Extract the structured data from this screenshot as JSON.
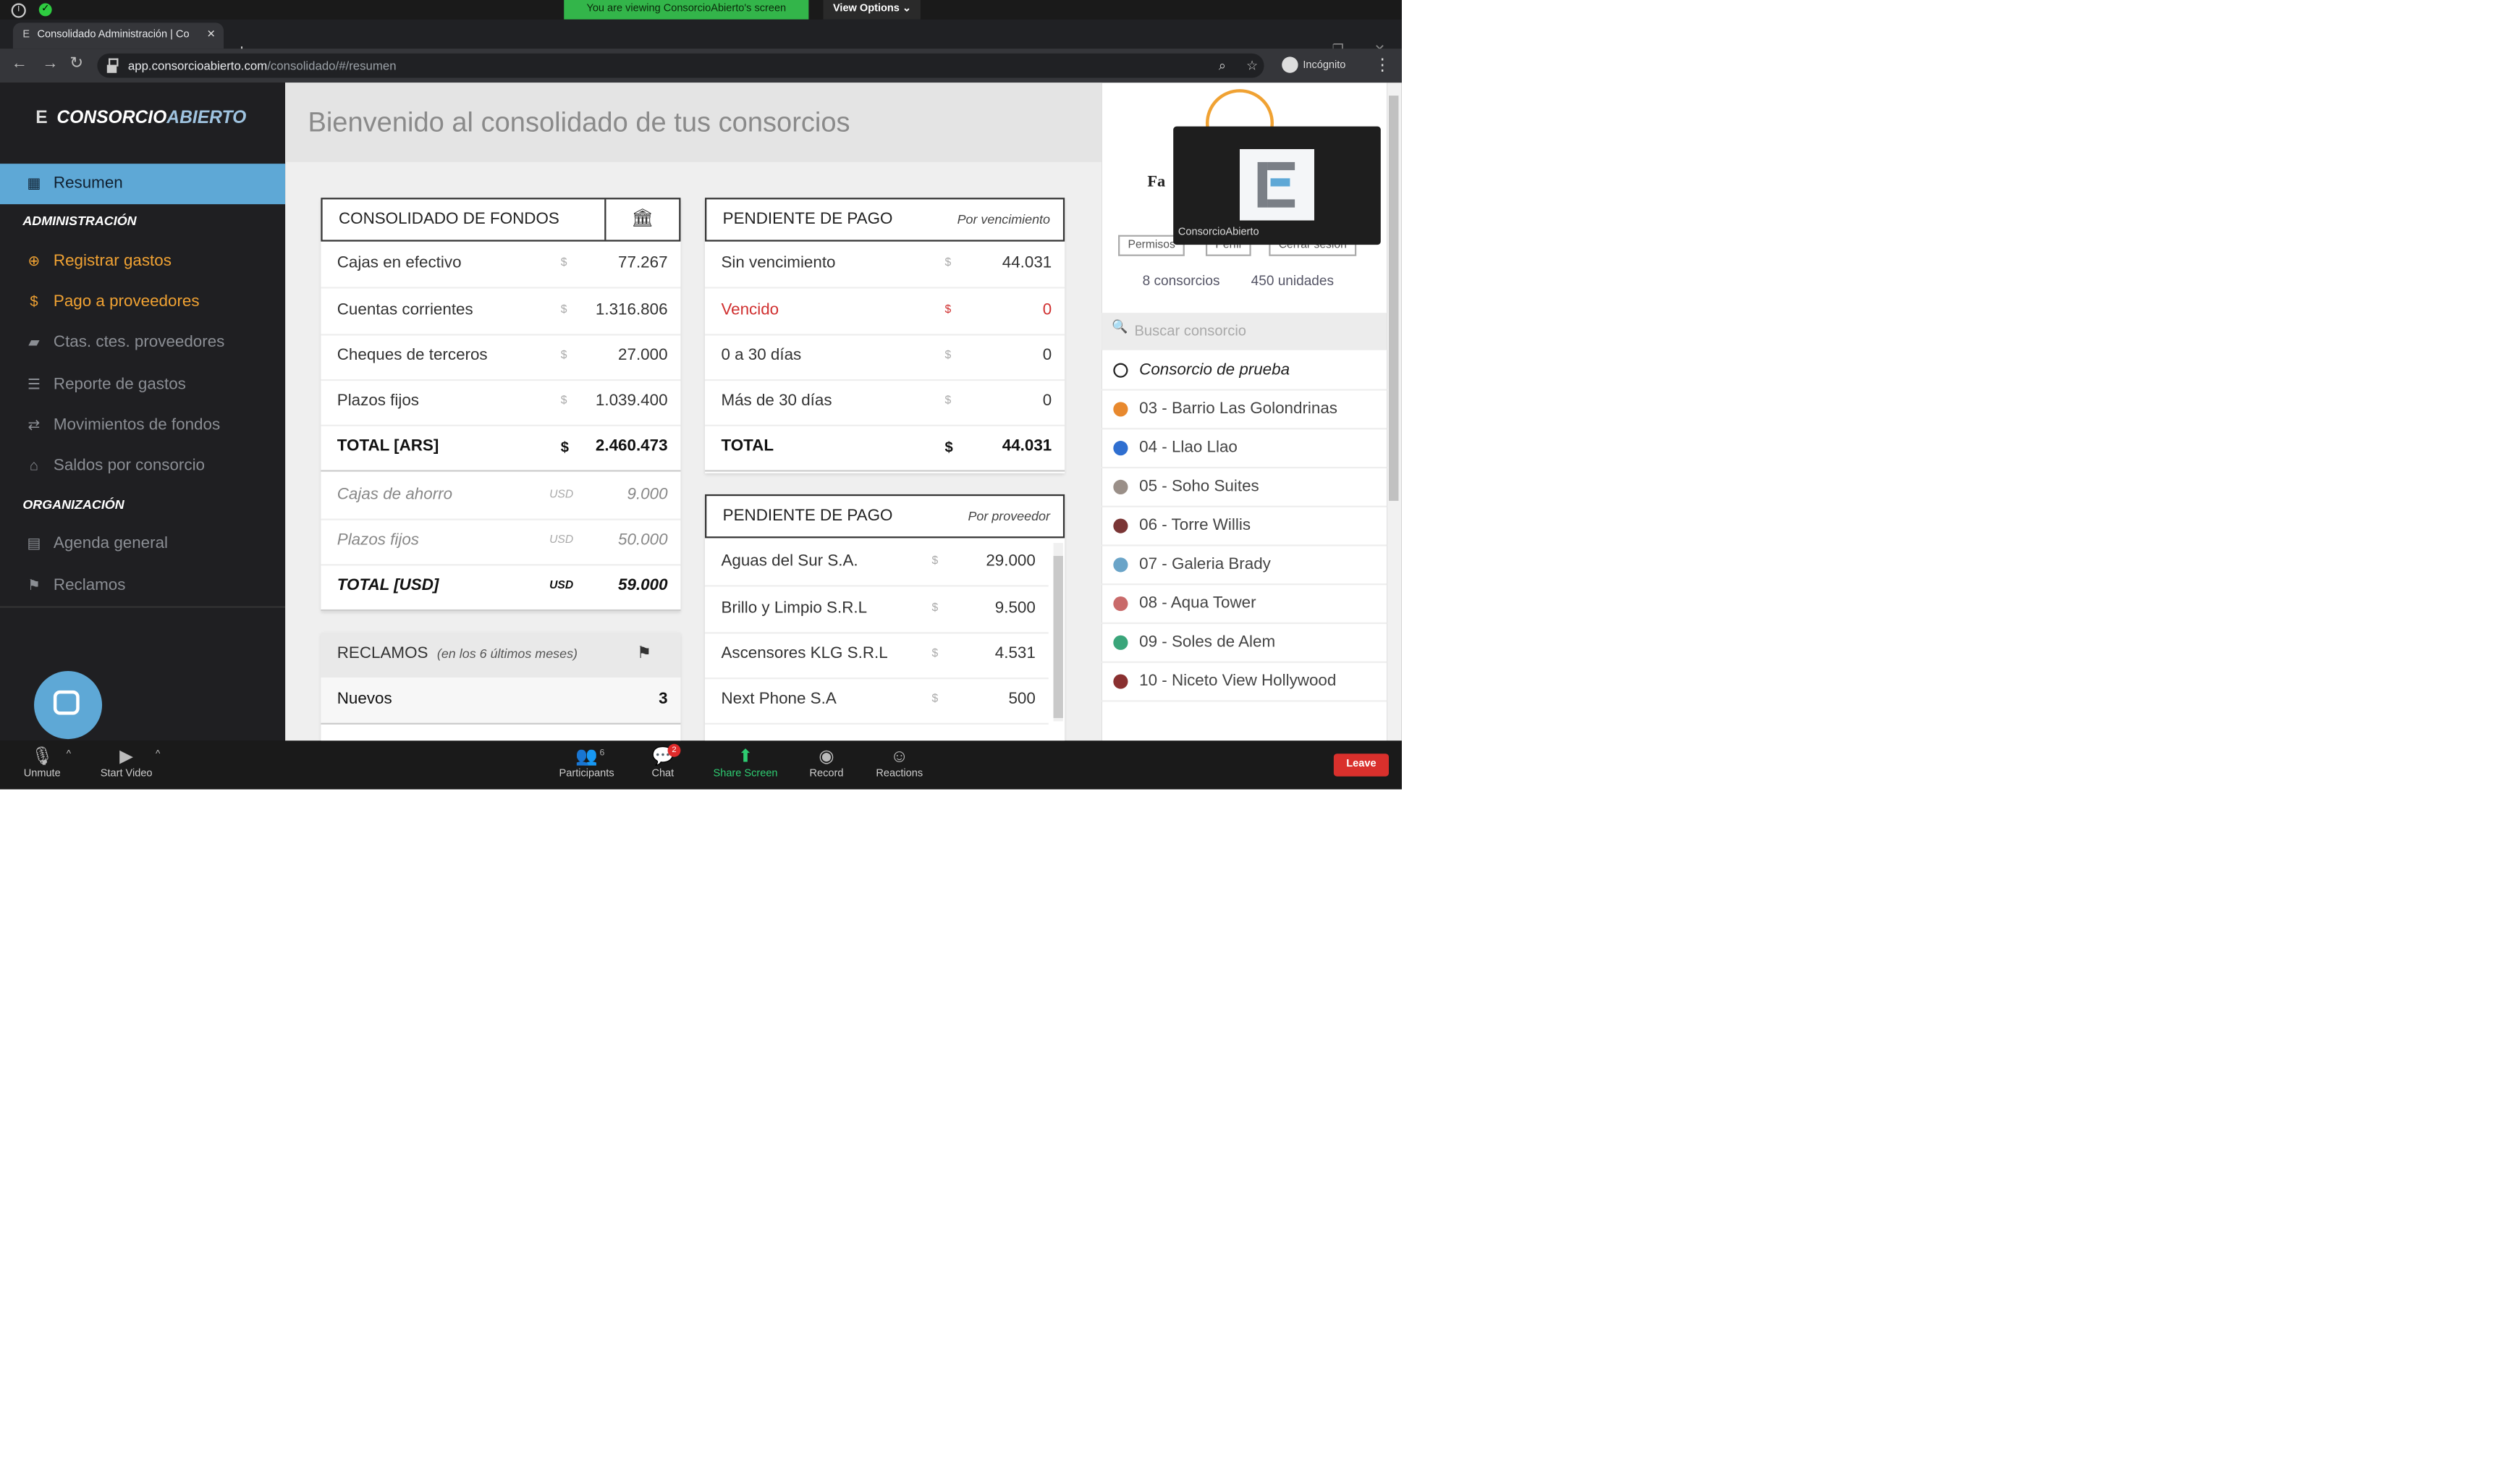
{
  "zoom": {
    "banner": "You are viewing ConsorcioAbierto's screen",
    "view_options": "View Options ⌄",
    "unmute": "Unmute",
    "start_video": "Start Video",
    "participants": "Participants",
    "participants_count": "6",
    "chat": "Chat",
    "chat_badge": "2",
    "share_screen": "Share Screen",
    "record": "Record",
    "reactions": "Reactions",
    "leave": "Leave",
    "video_tile_label": "ConsorcioAbierto"
  },
  "browser": {
    "tab_title": "Consolidado Administración | Co",
    "url_host": "app.consorcioabierto.com",
    "url_path": "/consolidado/#/resumen",
    "incognito": "Incógnito"
  },
  "sidebar": {
    "logo_a": "CONSORCIO",
    "logo_b": "ABIERTO",
    "resumen": "Resumen",
    "section_admin": "ADMINISTRACIÓN",
    "registrar": "Registrar gastos",
    "pago": "Pago a proveedores",
    "ctas": "Ctas. ctes. proveedores",
    "reporte": "Reporte de gastos",
    "movimientos": "Movimientos de fondos",
    "saldos": "Saldos por consorcio",
    "section_org": "ORGANIZACIÓN",
    "agenda": "Agenda general",
    "reclamos": "Reclamos"
  },
  "main": {
    "welcome": "Bienvenido al consolidado de tus consorcios",
    "fondos": {
      "title": "CONSOLIDADO DE FONDOS",
      "rows": [
        {
          "label": "Cajas en efectivo",
          "cur": "$",
          "value": "77.267"
        },
        {
          "label": "Cuentas corrientes",
          "cur": "$",
          "value": "1.316.806"
        },
        {
          "label": "Cheques de terceros",
          "cur": "$",
          "value": "27.000"
        },
        {
          "label": "Plazos fijos",
          "cur": "$",
          "value": "1.039.400"
        },
        {
          "label": "TOTAL [ARS]",
          "cur": "$",
          "value": "2.460.473"
        },
        {
          "label": "Cajas de ahorro",
          "cur": "USD",
          "value": "9.000"
        },
        {
          "label": "Plazos fijos",
          "cur": "USD",
          "value": "50.000"
        },
        {
          "label": "TOTAL [USD]",
          "cur": "USD",
          "value": "59.000"
        }
      ]
    },
    "venc": {
      "title": "PENDIENTE DE PAGO",
      "subtitle": "Por vencimiento",
      "rows": [
        {
          "label": "Sin vencimiento",
          "cur": "$",
          "value": "44.031"
        },
        {
          "label": "Vencido",
          "cur": "$",
          "value": "0"
        },
        {
          "label": "0 a 30 días",
          "cur": "$",
          "value": "0"
        },
        {
          "label": "Más de 30 días",
          "cur": "$",
          "value": "0"
        },
        {
          "label": "TOTAL",
          "cur": "$",
          "value": "44.031"
        }
      ]
    },
    "prov": {
      "title": "PENDIENTE DE PAGO",
      "subtitle": "Por proveedor",
      "rows": [
        {
          "label": "Aguas del Sur S.A.",
          "cur": "$",
          "value": "29.000"
        },
        {
          "label": "Brillo y Limpio S.R.L",
          "cur": "$",
          "value": "9.500"
        },
        {
          "label": "Ascensores KLG S.R.L",
          "cur": "$",
          "value": "4.531"
        },
        {
          "label": "Next Phone S.A",
          "cur": "$",
          "value": "500"
        }
      ]
    },
    "reclamos": {
      "title": "RECLAMOS",
      "subtitle": "(en los 6 últimos meses)",
      "rows": [
        {
          "label": "Nuevos",
          "value": "3"
        }
      ]
    }
  },
  "right": {
    "name_fragment": "Fa",
    "permisos": "Permisos",
    "perfil": "Perfil",
    "cerrar": "Cerrar sesión",
    "consorcios_count": "8 consorcios",
    "unidades_count": "450 unidades",
    "search_placeholder": "Buscar consorcio",
    "consorcios": [
      {
        "name": "Consorcio de prueba",
        "color": "#ffffff"
      },
      {
        "name": "03 - Barrio Las Golondrinas",
        "color": "#e8892e"
      },
      {
        "name": "04 - Llao Llao",
        "color": "#2f6fd0"
      },
      {
        "name": "05 - Soho Suites",
        "color": "#9a8f88"
      },
      {
        "name": "06 - Torre Willis",
        "color": "#7a3535"
      },
      {
        "name": "07 - Galeria Brady",
        "color": "#6aa4c8"
      },
      {
        "name": "08 - Aqua Tower",
        "color": "#c96a6a"
      },
      {
        "name": "09 - Soles de Alem",
        "color": "#3aa57a"
      },
      {
        "name": "10 - Niceto View Hollywood",
        "color": "#8a3030"
      }
    ]
  },
  "colors": {
    "accent_blue": "#5ea8d6",
    "accent_orange": "#f0a233",
    "zoom_green": "#33b54a",
    "leave_red": "#d9302c"
  }
}
